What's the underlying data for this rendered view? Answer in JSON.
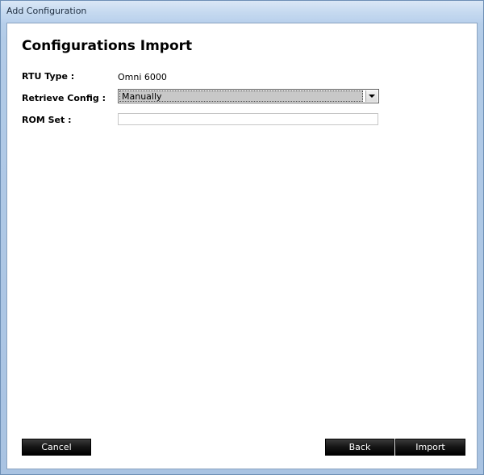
{
  "window": {
    "title": "Add Configuration"
  },
  "page": {
    "heading": "Configurations Import"
  },
  "form": {
    "rtu_type": {
      "label": "RTU Type :",
      "value": "Omni 6000"
    },
    "retrieve_config": {
      "label": "Retrieve Config :",
      "selected": "Manually"
    },
    "rom_set": {
      "label": "ROM Set :",
      "value": ""
    }
  },
  "buttons": {
    "cancel": "Cancel",
    "back": "Back",
    "import": "Import"
  },
  "colors": {
    "window_frame": "#b2cbe7",
    "button_bg": "#000000",
    "button_text": "#ffffff",
    "client_bg": "#ffffff"
  },
  "icons": {
    "dropdown": "chevron-down-icon"
  }
}
